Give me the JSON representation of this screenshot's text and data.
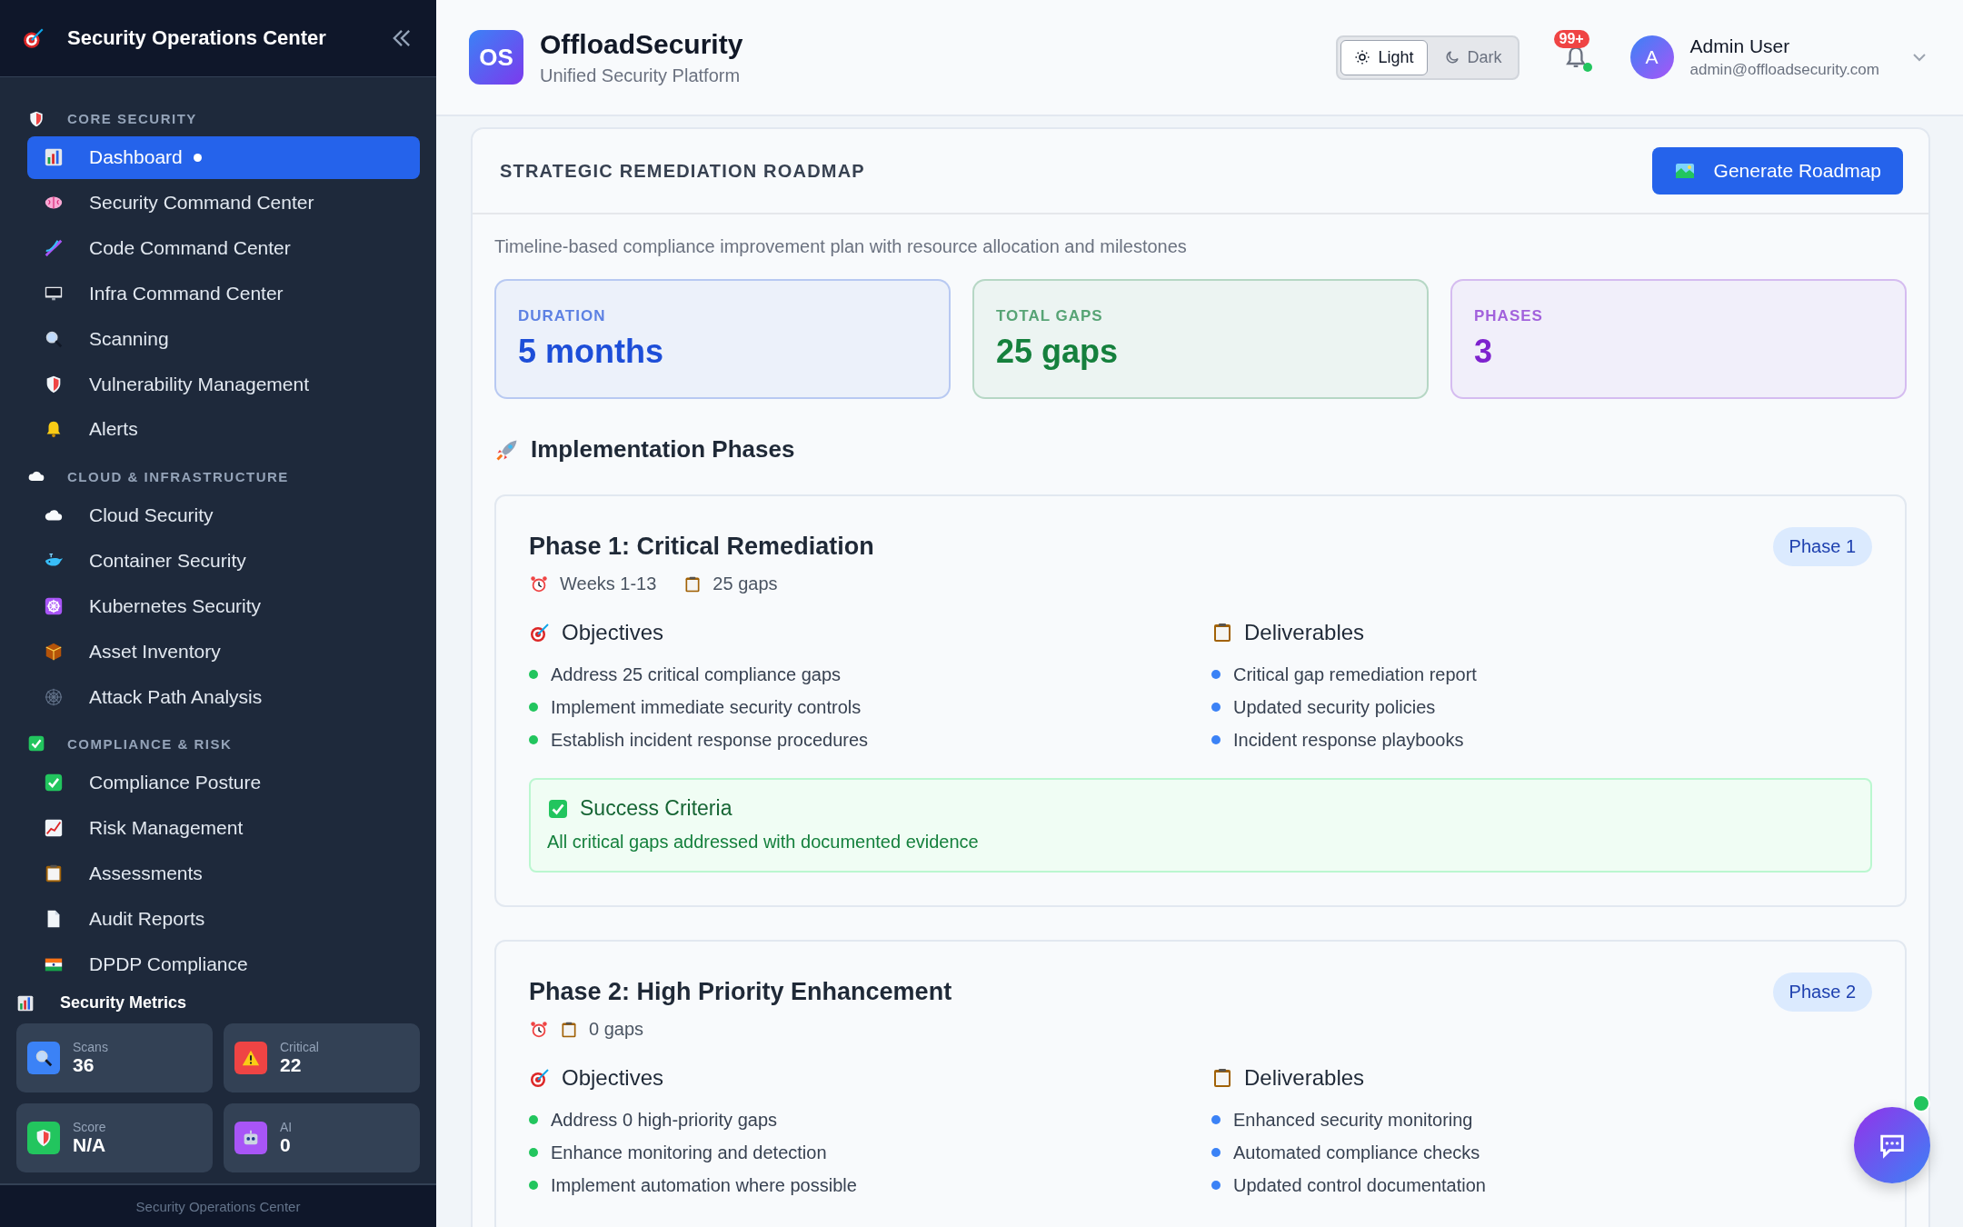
{
  "sidebar": {
    "title": "Security Operations Center",
    "sections": [
      {
        "label": "CORE SECURITY",
        "items": [
          {
            "label": "Dashboard",
            "selected": true
          },
          {
            "label": "Security Command Center",
            "selected": false
          },
          {
            "label": "Code Command Center",
            "selected": false
          },
          {
            "label": "Infra Command Center",
            "selected": false
          },
          {
            "label": "Scanning",
            "selected": false
          },
          {
            "label": "Vulnerability Management",
            "selected": false
          },
          {
            "label": "Alerts",
            "selected": false
          }
        ]
      },
      {
        "label": "CLOUD & INFRASTRUCTURE",
        "items": [
          {
            "label": "Cloud Security",
            "selected": false
          },
          {
            "label": "Container Security",
            "selected": false
          },
          {
            "label": "Kubernetes Security",
            "selected": false
          },
          {
            "label": "Asset Inventory",
            "selected": false
          },
          {
            "label": "Attack Path Analysis",
            "selected": false
          }
        ]
      },
      {
        "label": "COMPLIANCE & RISK",
        "items": [
          {
            "label": "Compliance Posture",
            "selected": false
          },
          {
            "label": "Risk Management",
            "selected": false
          },
          {
            "label": "Assessments",
            "selected": false
          },
          {
            "label": "Audit Reports",
            "selected": false
          },
          {
            "label": "DPDP Compliance",
            "selected": false
          }
        ]
      }
    ],
    "metrics": {
      "title": "Security Metrics",
      "cards": [
        {
          "label": "Scans",
          "value": "36",
          "color": "#3b82f6"
        },
        {
          "label": "Critical",
          "value": "22",
          "color": "#ef4444"
        },
        {
          "label": "Score",
          "value": "N/A",
          "color": "#22c55e"
        },
        {
          "label": "AI",
          "value": "0",
          "color": "#a855f7"
        }
      ]
    },
    "footer": "Security Operations Center"
  },
  "header": {
    "logo": "OS",
    "brand": "OffloadSecurity",
    "tagline": "Unified Security Platform",
    "theme": [
      {
        "label": "Light",
        "selected": true
      },
      {
        "label": "Dark",
        "selected": false
      }
    ],
    "notifications": {
      "badge": "99+"
    },
    "user": {
      "initial": "A",
      "name": "Admin User",
      "email": "admin@offloadsecurity.com"
    }
  },
  "roadmap": {
    "title": "STRATEGIC REMEDIATION ROADMAP",
    "button": "Generate Roadmap",
    "description": "Timeline-based compliance improvement plan with resource allocation and milestones",
    "stats": [
      {
        "label": "DURATION",
        "value": "5 months",
        "color": "#1d4ed8"
      },
      {
        "label": "TOTAL GAPS",
        "value": "25 gaps",
        "color": "#15803d"
      },
      {
        "label": "PHASES",
        "value": "3",
        "color": "#7e22ce"
      }
    ],
    "phases_title": "Implementation Phases",
    "phases": [
      {
        "title": "Phase 1: Critical Remediation",
        "badge": "Phase 1",
        "weeks": "Weeks 1-13",
        "gaps": "25 gaps",
        "objectives_title": "Objectives",
        "objectives": [
          "Address 25 critical compliance gaps",
          "Implement immediate security controls",
          "Establish incident response procedures"
        ],
        "deliverables_title": "Deliverables",
        "deliverables": [
          "Critical gap remediation report",
          "Updated security policies",
          "Incident response playbooks"
        ],
        "success": {
          "title": "Success Criteria",
          "text": "All critical gaps addressed with documented evidence"
        }
      },
      {
        "title": "Phase 2: High Priority Enhancement",
        "badge": "Phase 2",
        "gaps": "0 gaps",
        "objectives_title": "Objectives",
        "objectives": [
          "Address 0 high-priority gaps",
          "Enhance monitoring and detection",
          "Implement automation where possible"
        ],
        "deliverables_title": "Deliverables",
        "deliverables": [
          "Enhanced security monitoring",
          "Automated compliance checks",
          "Updated control documentation"
        ]
      }
    ]
  }
}
